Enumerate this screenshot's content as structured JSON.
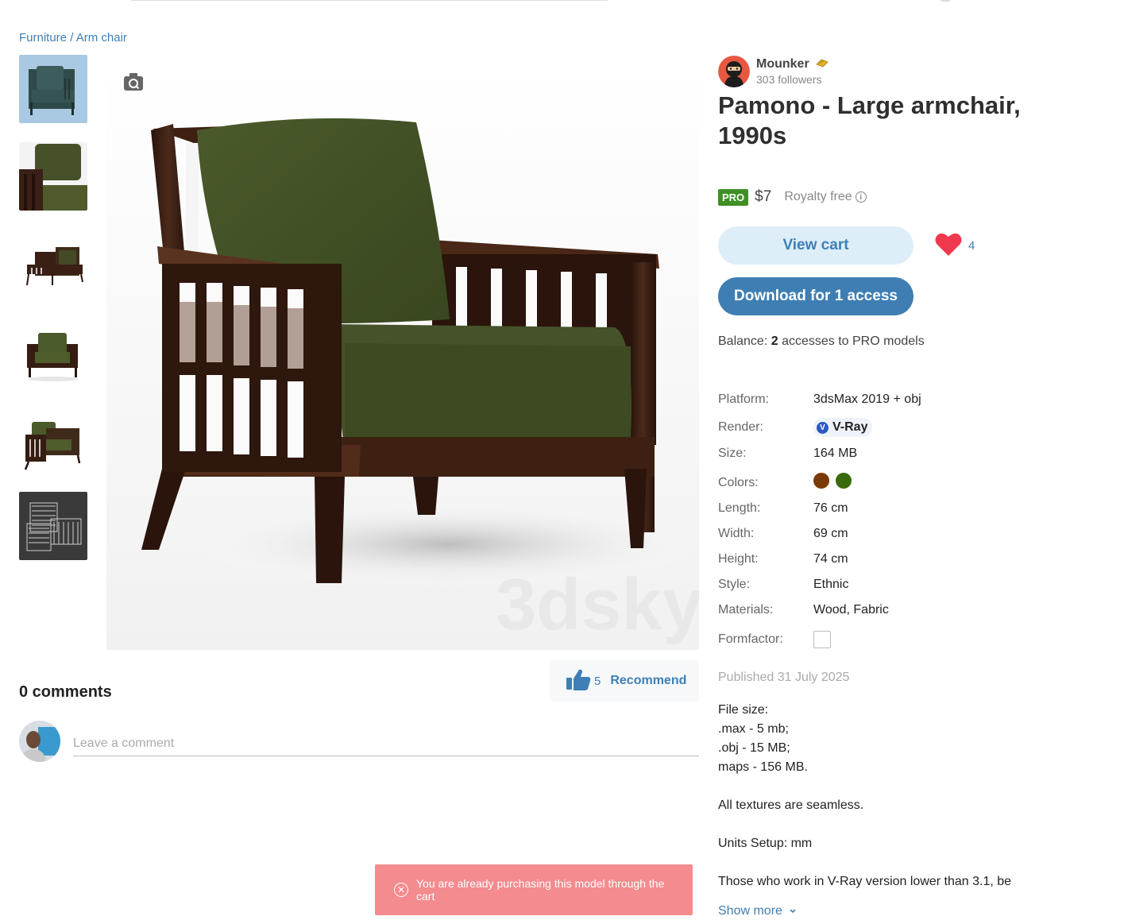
{
  "breadcrumb": {
    "category": "Furniture",
    "separator": " / ",
    "subcategory": "Arm chair"
  },
  "thumbnails": [
    {
      "name": "thumb-blue-background"
    },
    {
      "name": "thumb-close-up"
    },
    {
      "name": "thumb-side-view"
    },
    {
      "name": "thumb-front-view"
    },
    {
      "name": "thumb-angle-view"
    },
    {
      "name": "thumb-wireframe"
    }
  ],
  "main_image": {
    "watermark": "3dsky",
    "camera_icon": "camera-icon"
  },
  "recommend": {
    "count": "5",
    "label": "Recommend"
  },
  "comments": {
    "title": "0 comments",
    "placeholder": "Leave a comment"
  },
  "toast": {
    "message": "You are already purchasing this model through the cart"
  },
  "author": {
    "name": "Mounker",
    "followers": "303 followers"
  },
  "product": {
    "title": "Pamono - Large armchair, 1990s",
    "pro_badge": "PRO",
    "price": "$7",
    "license": "Royalty free",
    "view_cart": "View cart",
    "download": "Download for 1 access",
    "likes": "4",
    "balance_prefix": "Balance: ",
    "balance_value": "2",
    "balance_suffix": " accesses to PRO models"
  },
  "specs": {
    "platform_label": "Platform:",
    "platform_value": "3dsMax 2019 + obj",
    "render_label": "Render:",
    "render_value": "V-Ray",
    "size_label": "Size:",
    "size_value": "164 MB",
    "colors_label": "Colors:",
    "colors": [
      "#7a3a05",
      "#3a6a0b"
    ],
    "length_label": "Length:",
    "length_value": "76 cm",
    "width_label": "Width:",
    "width_value": "69 cm",
    "height_label": "Height:",
    "height_value": "74 cm",
    "style_label": "Style:",
    "style_value": "Ethnic",
    "materials_label": "Materials:",
    "materials_value": "Wood, Fabric",
    "formfactor_label": "Formfactor:"
  },
  "published": "Published 31 July 2025",
  "description": [
    "File size:",
    ".max - 5 mb;",
    ".obj - 15 MB;",
    "maps - 156 MB.",
    "",
    "All textures are seamless.",
    "",
    "Units Setup: mm",
    "",
    "Those who work in V-Ray version lower than 3.1, be"
  ],
  "show_more": "Show more"
}
